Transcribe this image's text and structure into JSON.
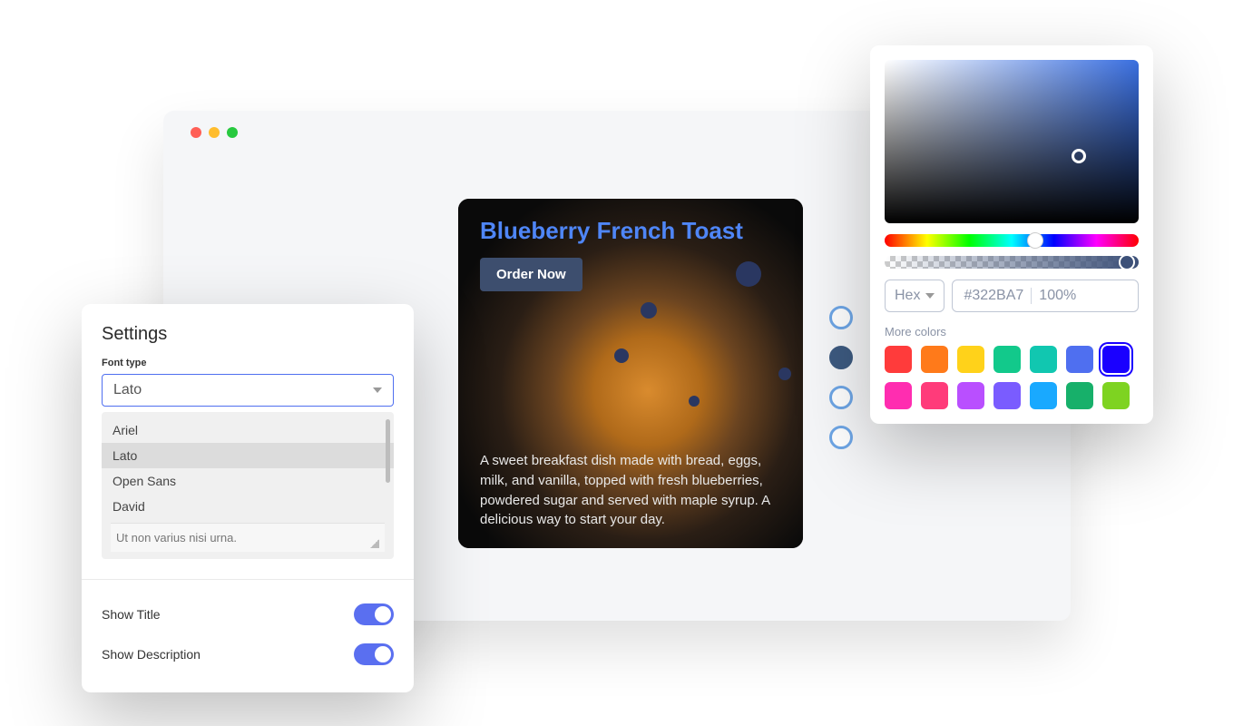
{
  "browser": {},
  "card": {
    "title": "Blueberry French Toast",
    "button": "Order Now",
    "description": "A sweet breakfast dish made with bread, eggs, milk, and vanilla, topped with fresh blueberries, powdered sugar and served with maple syrup. A delicious way to start your day."
  },
  "settings": {
    "title": "Settings",
    "font": {
      "label": "Font type",
      "selected": "Lato",
      "options": [
        "Ariel",
        "Lato",
        "Open Sans",
        "David"
      ],
      "placeholder": "Ut non varius nisi urna."
    },
    "toggles": {
      "showTitle": {
        "label": "Show Title",
        "on": true
      },
      "showDescription": {
        "label": "Show Description",
        "on": true
      }
    }
  },
  "picker": {
    "formatLabel": "Hex",
    "hex": "#322BA7",
    "opacity": "100%",
    "moreLabel": "More colors",
    "swatches": [
      "#ff3b3b",
      "#ff7a1a",
      "#ffd21a",
      "#12c98b",
      "#11c7b0",
      "#4f6ff0",
      "#1a00ff",
      "#ff2db0",
      "#ff3b7a",
      "#b94fff",
      "#7a5cff",
      "#19a9ff",
      "#17b06a",
      "#7ed321"
    ],
    "selectedSwatchIndex": 6
  }
}
